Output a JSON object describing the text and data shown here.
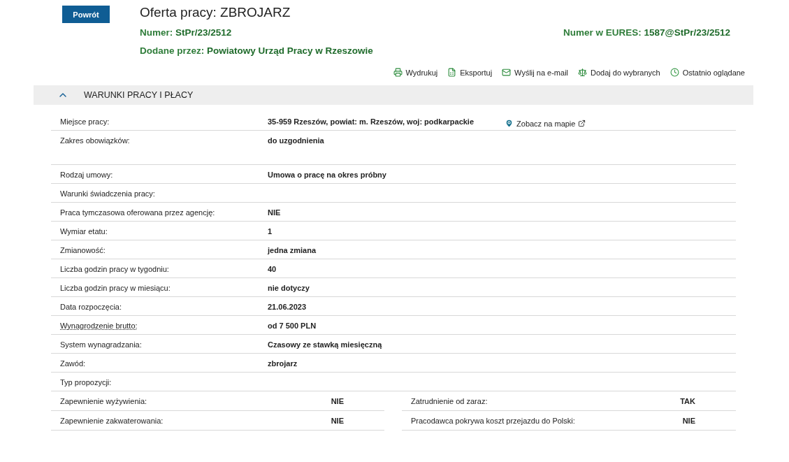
{
  "back_button": "Powrót",
  "title": "Oferta pracy: ZBROJARZ",
  "number": {
    "label": "Numer:",
    "value": "StPr/23/2512"
  },
  "eures": {
    "label": "Numer w EURES:",
    "value": "1587@StPr/23/2512"
  },
  "added_by": {
    "label": "Dodane przez:",
    "value": "Powiatowy Urząd Pracy w Rzeszowie"
  },
  "actions": [
    {
      "kind": "print",
      "label": "Wydrukuj"
    },
    {
      "kind": "export",
      "label": "Eksportuj"
    },
    {
      "kind": "mail",
      "label": "Wyślij na e-mail"
    },
    {
      "kind": "compare",
      "label": "Dodaj do wybranych"
    },
    {
      "kind": "history",
      "label": "Ostatnio oglądane"
    }
  ],
  "section": {
    "title": "WARUNKI PRACY I PŁACY",
    "expanded": true
  },
  "rows": [
    {
      "label": "Miejsce pracy:",
      "value": "35-959 Rzeszów, powiat: m. Rzeszów, woj: podkarpackie",
      "link": "Zobacz na mapie",
      "tall": false,
      "tooltip": false
    },
    {
      "label": "Zakres obowiązków:",
      "value": "do uzgodnienia",
      "tall": true,
      "tooltip": false
    },
    {
      "label": "Rodzaj umowy:",
      "value": "Umowa o pracę na okres próbny",
      "tall": false,
      "tooltip": false
    },
    {
      "label": "Warunki świadczenia pracy:",
      "tall": false,
      "tooltip": false
    },
    {
      "label": "Praca tymczasowa oferowana przez agencję:",
      "value": "NIE",
      "tall": false,
      "tooltip": false
    },
    {
      "label": "Wymiar etatu:",
      "value": "1",
      "tall": false,
      "tooltip": false
    },
    {
      "label": "Zmianowość:",
      "value": "jedna zmiana",
      "tall": false,
      "tooltip": false
    },
    {
      "label": "Liczba godzin pracy w tygodniu:",
      "value": "40",
      "tall": false,
      "tooltip": false
    },
    {
      "label": "Liczba godzin pracy w miesiącu:",
      "value": "nie dotyczy",
      "tall": false,
      "tooltip": false
    },
    {
      "label": "Data rozpoczęcia:",
      "value": "21.06.2023",
      "tall": false,
      "tooltip": false
    },
    {
      "label": "Wynagrodzenie brutto:",
      "value": "od 7 500 PLN",
      "tall": false,
      "tooltip": true
    },
    {
      "label": "System wynagradzania:",
      "value": "Czasowy ze stawką miesięczną",
      "tall": false,
      "tooltip": false
    },
    {
      "label": "Zawód:",
      "value": "zbrojarz",
      "tall": false,
      "tooltip": false
    },
    {
      "label": "Typ propozycji:",
      "tall": false,
      "tooltip": false
    }
  ],
  "pairs": [
    [
      {
        "label": "Zapewnienie wyżywienia:",
        "value": "NIE"
      },
      {
        "label": "Zatrudnienie od zaraz:",
        "value": "TAK"
      }
    ],
    [
      {
        "label": "Zapewnienie zakwaterowania:",
        "value": "NIE"
      },
      {
        "label": "Pracodawca pokrywa koszt przejazdu do Polski:",
        "value": "NIE"
      }
    ]
  ]
}
